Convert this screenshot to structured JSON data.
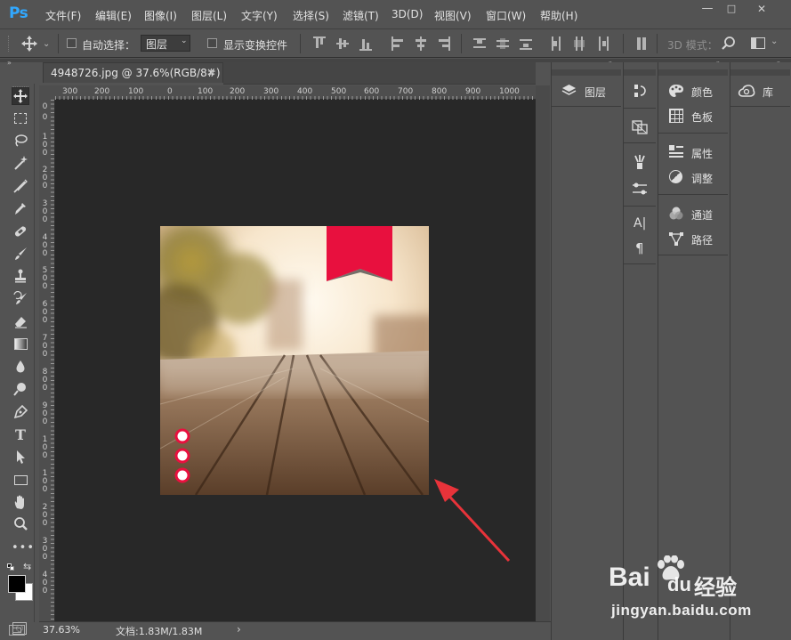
{
  "app": {
    "logo": "Ps"
  },
  "menu": [
    "文件(F)",
    "编辑(E)",
    "图像(I)",
    "图层(L)",
    "文字(Y)",
    "选择(S)",
    "滤镜(T)",
    "3D(D)",
    "视图(V)",
    "窗口(W)",
    "帮助(H)"
  ],
  "window_controls": {
    "minimize": "—",
    "maximize": "□",
    "close": "✕"
  },
  "options": {
    "auto_select_label": "自动选择：",
    "auto_select_value": "图层",
    "show_transform_label": "显示变换控件",
    "mode_3d_label": "3D 模式："
  },
  "document": {
    "tab_title": "4948726.jpg @ 37.6%(RGB/8#)",
    "close_glyph": "×"
  },
  "ruler": {
    "top_ticks": [
      "300",
      "200",
      "100",
      "0",
      "100",
      "200",
      "300",
      "400",
      "500",
      "600",
      "700",
      "800",
      "900",
      "1000"
    ],
    "left_ticks": [
      "0",
      "0",
      "1 0 0",
      "2 0 0",
      "3 0 0",
      "4 0 0",
      "5 0 0",
      "6 0 0",
      "7 0 0",
      "8 0 0",
      "9 0 0",
      "1 0 0"
    ]
  },
  "status": {
    "zoom": "37.63%",
    "doc_info": "文档:1.83M/1.83M",
    "arrow": "›"
  },
  "panels": {
    "layers": "图层",
    "color": "颜色",
    "swatches": "色板",
    "properties": "属性",
    "adjustments": "调整",
    "channels": "通道",
    "paths": "路径",
    "libraries": "库",
    "char_icon": "A|",
    "para_icon": "¶"
  },
  "watermark": {
    "brand": "Bai",
    "brand2": "du",
    "jingyan": "经验",
    "url": "jingyan.baidu.com"
  },
  "colors": {
    "accent": "#31a8ff",
    "ribbon": "#e8103e",
    "arrow": "#e8333a"
  }
}
